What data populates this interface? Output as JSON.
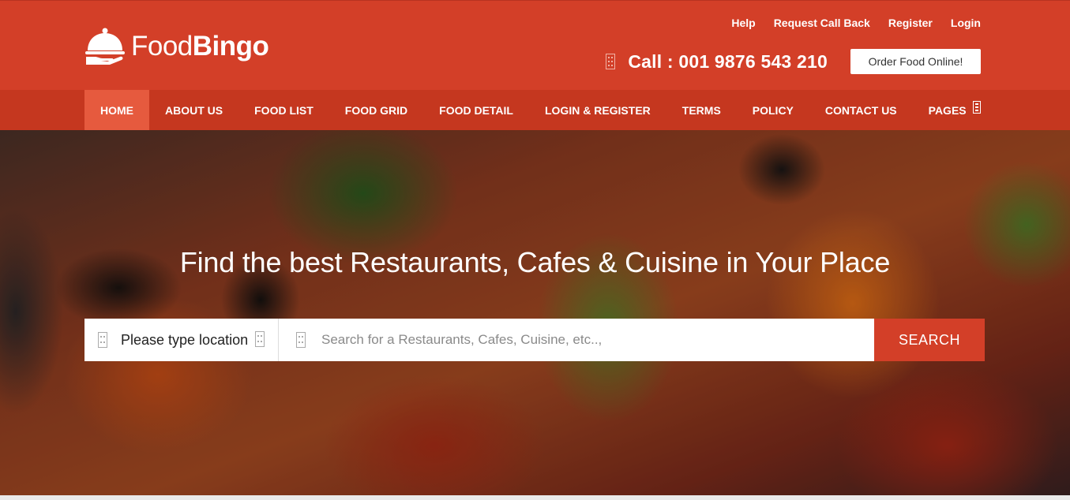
{
  "brand": {
    "name_light": "Food",
    "name_bold": "Bingo",
    "color": "#d33f28"
  },
  "top_links": [
    "Help",
    "Request Call Back",
    "Register",
    "Login"
  ],
  "call": {
    "icon": "mobile-phone-icon",
    "text": "Call : 001 9876 543 210"
  },
  "order_button": "Order Food Online!",
  "nav": {
    "items": [
      "HOME",
      "ABOUT US",
      "FOOD LIST",
      "FOOD GRID",
      "FOOD DETAIL",
      "LOGIN & REGISTER",
      "TERMS",
      "POLICY",
      "CONTACT US",
      "PAGES"
    ],
    "active_index": 0,
    "active_color": "#e65a3e"
  },
  "hero": {
    "title": "Find the best Restaurants, Cafes & Cuisine in Your Place",
    "location_value": "Please type location",
    "search_placeholder": "Search for a Restaurants, Cafes, Cuisine, etc..,",
    "search_button": "SEARCH"
  }
}
